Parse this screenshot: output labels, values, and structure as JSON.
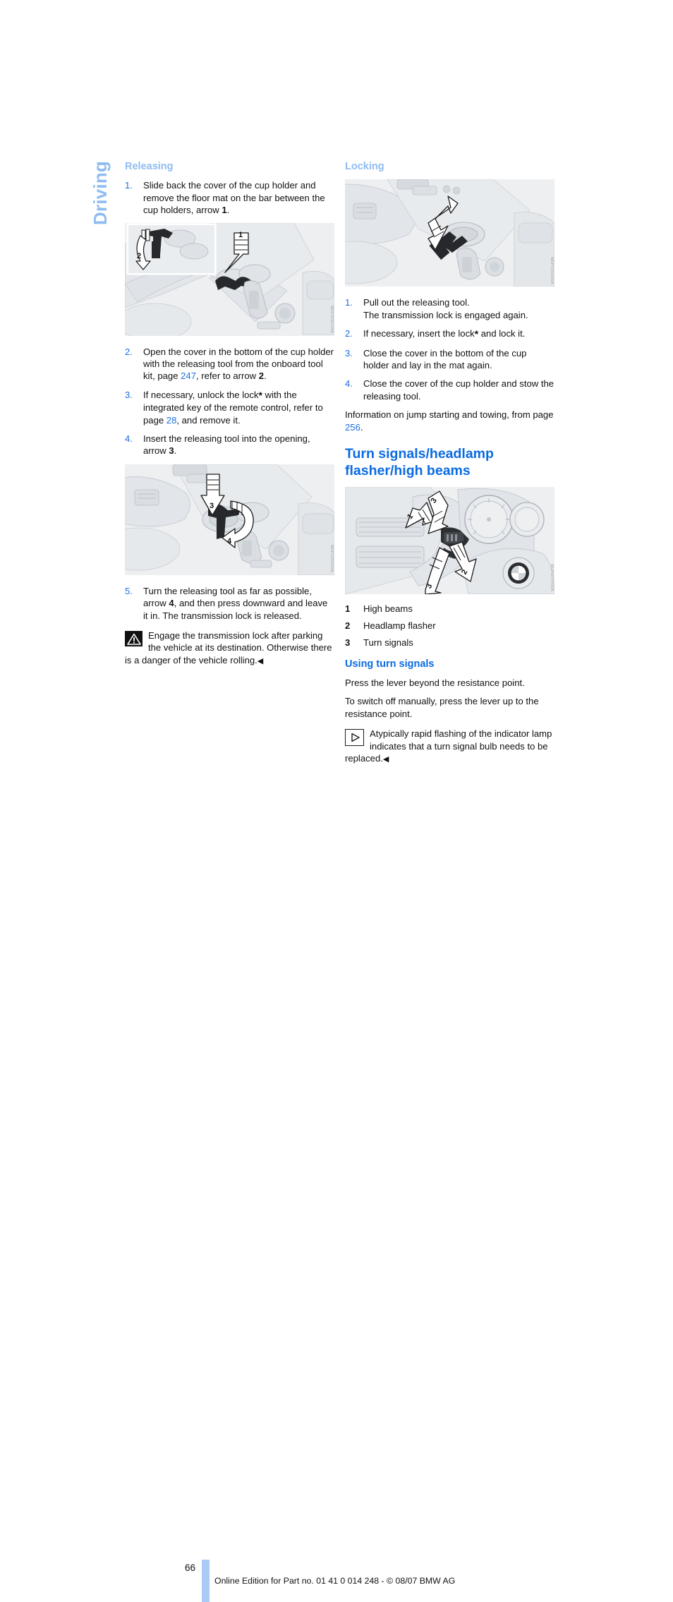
{
  "chapter": {
    "label": "Driving"
  },
  "left_column": {
    "heading": "Releasing",
    "steps": [
      {
        "num": "1.",
        "html": "Slide back the cover of the cup holder and remove the floor mat on the bar between the cup holders, arrow <b>1</b>."
      },
      {
        "num": "2.",
        "html": "Open the cover in the bottom of the cup holder with the releasing tool from the onboard tool kit, page <a class=\"pref\">247</a>, refer to arrow <b>2</b>."
      },
      {
        "num": "3.",
        "html": "If necessary, unlock the lock<span class=\"star\">*</span> with the integrated key of the remote control, refer to page <a class=\"pref\">28</a>, and remove it."
      },
      {
        "num": "4.",
        "html": "Insert the releasing tool into the opening, arrow <b>3</b>."
      },
      {
        "num": "5.",
        "html": "Turn the releasing tool as far as possible, arrow <b>4</b>, and then press downward and leave it in. The transmission lock is released."
      }
    ],
    "figure_1": {
      "name": "cup-holder-cover-illustration",
      "callouts": [
        "1",
        "2"
      ],
      "code": "WDP2150100A"
    },
    "figure_2": {
      "name": "releasing-tool-insert-illustration",
      "callouts": [
        "3",
        "4"
      ],
      "code": "WDP2150200A"
    },
    "warning": {
      "icon": "warning-triangle-icon",
      "text": "Engage the transmission lock after parking the vehicle at its destination. Otherwise there is a danger of the vehicle rolling.",
      "endmark": "◀"
    }
  },
  "right_column": {
    "heading": "Locking",
    "figure_1": {
      "name": "locking-tool-illustration",
      "callouts": [],
      "code": "WDP2150300A"
    },
    "steps": [
      {
        "num": "1.",
        "html": "Pull out the releasing tool.<br>The transmission lock is engaged again."
      },
      {
        "num": "2.",
        "html": "If necessary, insert the lock<span class=\"star\">*</span> and lock it."
      },
      {
        "num": "3.",
        "html": "Close the cover in the bottom of the cup holder and lay in the mat again."
      },
      {
        "num": "4.",
        "html": "Close the cover of the cup holder and stow the releasing tool."
      }
    ],
    "info_html": "Information on jump starting and towing, from page <a class=\"pref\">256</a>.",
    "major_heading": "Turn signals/headlamp flasher/high beams",
    "figure_2": {
      "name": "turn-signal-stalk-illustration",
      "callouts": [
        "1",
        "2",
        "3"
      ],
      "code": "WDP2270400A"
    },
    "legend": [
      {
        "key": "1",
        "label": "High beams"
      },
      {
        "key": "2",
        "label": "Headlamp flasher"
      },
      {
        "key": "3",
        "label": "Turn signals"
      }
    ],
    "sub_heading": "Using turn signals",
    "paragraphs": [
      "Press the lever beyond the resistance point.",
      "To switch off manually, press the lever up to the resistance point."
    ],
    "note": {
      "icon": "play-triangle-note-icon",
      "text": "Atypically rapid flashing of the indicator lamp indicates that a turn signal bulb needs to be replaced.",
      "endmark": "◀"
    }
  },
  "footer": {
    "page_number": "66",
    "line": "Online Edition for Part no. 01 41 0 014 248 - © 08/07 BMW AG"
  },
  "colors": {
    "chapter_blue": "#8FBCF2",
    "heading_light_blue": "#8FBCF2",
    "heading_blue": "#0A6BE1",
    "link_blue": "#1B6FE0",
    "footer_bar": "#A9CBF5",
    "figure_bg": "#EDEFF1"
  }
}
